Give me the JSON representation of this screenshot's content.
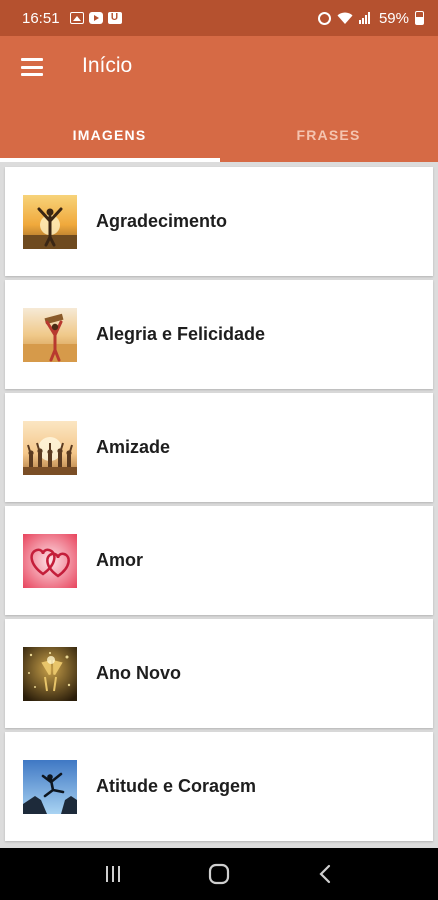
{
  "status_bar": {
    "time": "16:51",
    "battery": "59%",
    "left_icons": [
      "gallery-icon",
      "youtube-icon",
      "u-app-icon"
    ],
    "right_icons": [
      "alarm-icon",
      "wifi-icon",
      "signal-icon",
      "battery-icon"
    ]
  },
  "app_bar": {
    "title": "Início",
    "menu_icon": "hamburger-menu-icon",
    "color": "#d66a45"
  },
  "tabs": [
    {
      "label": "IMAGENS",
      "active": true
    },
    {
      "label": "FRASES",
      "active": false
    }
  ],
  "categories": [
    {
      "label": "Agradecimento",
      "thumb": "sunset-person-thumbnail"
    },
    {
      "label": "Alegria e Felicidade",
      "thumb": "field-person-thumbnail"
    },
    {
      "label": "Amizade",
      "thumb": "friends-sunset-thumbnail"
    },
    {
      "label": "Amor",
      "thumb": "hearts-thumbnail"
    },
    {
      "label": "Ano Novo",
      "thumb": "champagne-thumbnail"
    },
    {
      "label": "Atitude e Coragem",
      "thumb": "jumping-person-thumbnail"
    }
  ],
  "nav_bar": {
    "buttons": [
      "recent-apps-icon",
      "home-icon",
      "back-icon"
    ]
  }
}
